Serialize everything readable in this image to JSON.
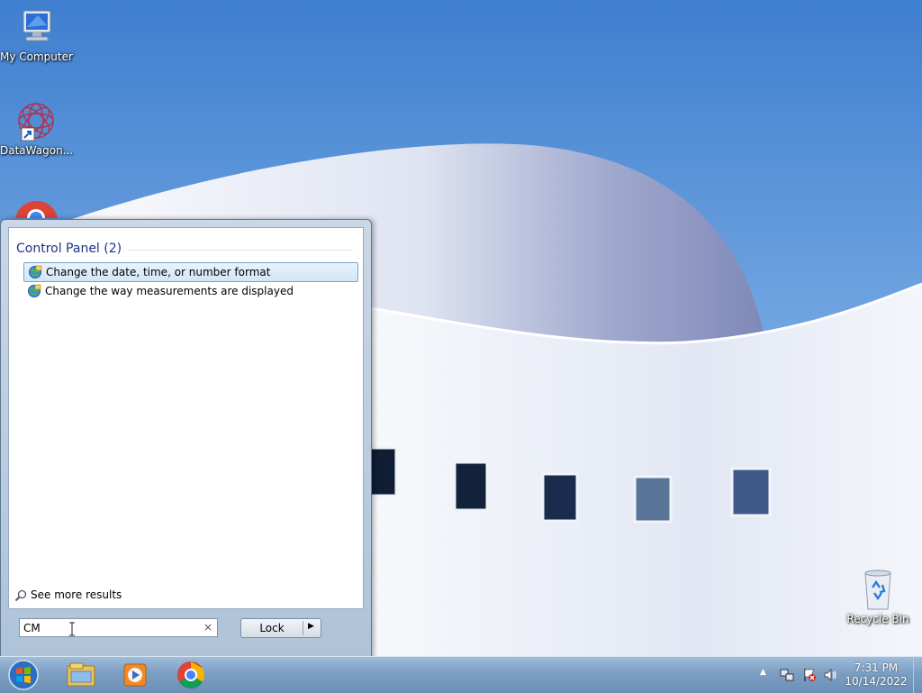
{
  "desktop": {
    "icons": [
      {
        "label": "My Computer",
        "icon": "computer-icon"
      },
      {
        "label": "DataWagon...",
        "icon": "datawagon-icon"
      },
      {
        "label": "",
        "icon": "chrome-icon"
      },
      {
        "label": "Recycle Bin",
        "icon": "recycle-bin-icon"
      }
    ]
  },
  "start_menu": {
    "group_header": "Control Panel (2)",
    "results": [
      {
        "label": "Change the date, time, or number format",
        "selected": true,
        "icon": "control-panel-globe-icon"
      },
      {
        "label": "Change the way measurements are displayed",
        "selected": false,
        "icon": "control-panel-globe-icon"
      }
    ],
    "see_more": "See more results",
    "search_value": "CM",
    "search_clear": "×",
    "lock_label": "Lock",
    "lock_arrow": "▶"
  },
  "taskbar": {
    "pinned": [
      "windows-explorer-icon",
      "media-player-icon",
      "chrome-icon"
    ],
    "tray_arrow": "▲",
    "tray_icons": [
      "network-icon",
      "action-center-flag-icon",
      "volume-icon"
    ],
    "time": "7:31 PM",
    "date": "10/14/2022"
  },
  "colors": {
    "accent": "#1e3287",
    "selection_border": "#7da2ce",
    "taskbar": "#7c9ec3"
  }
}
